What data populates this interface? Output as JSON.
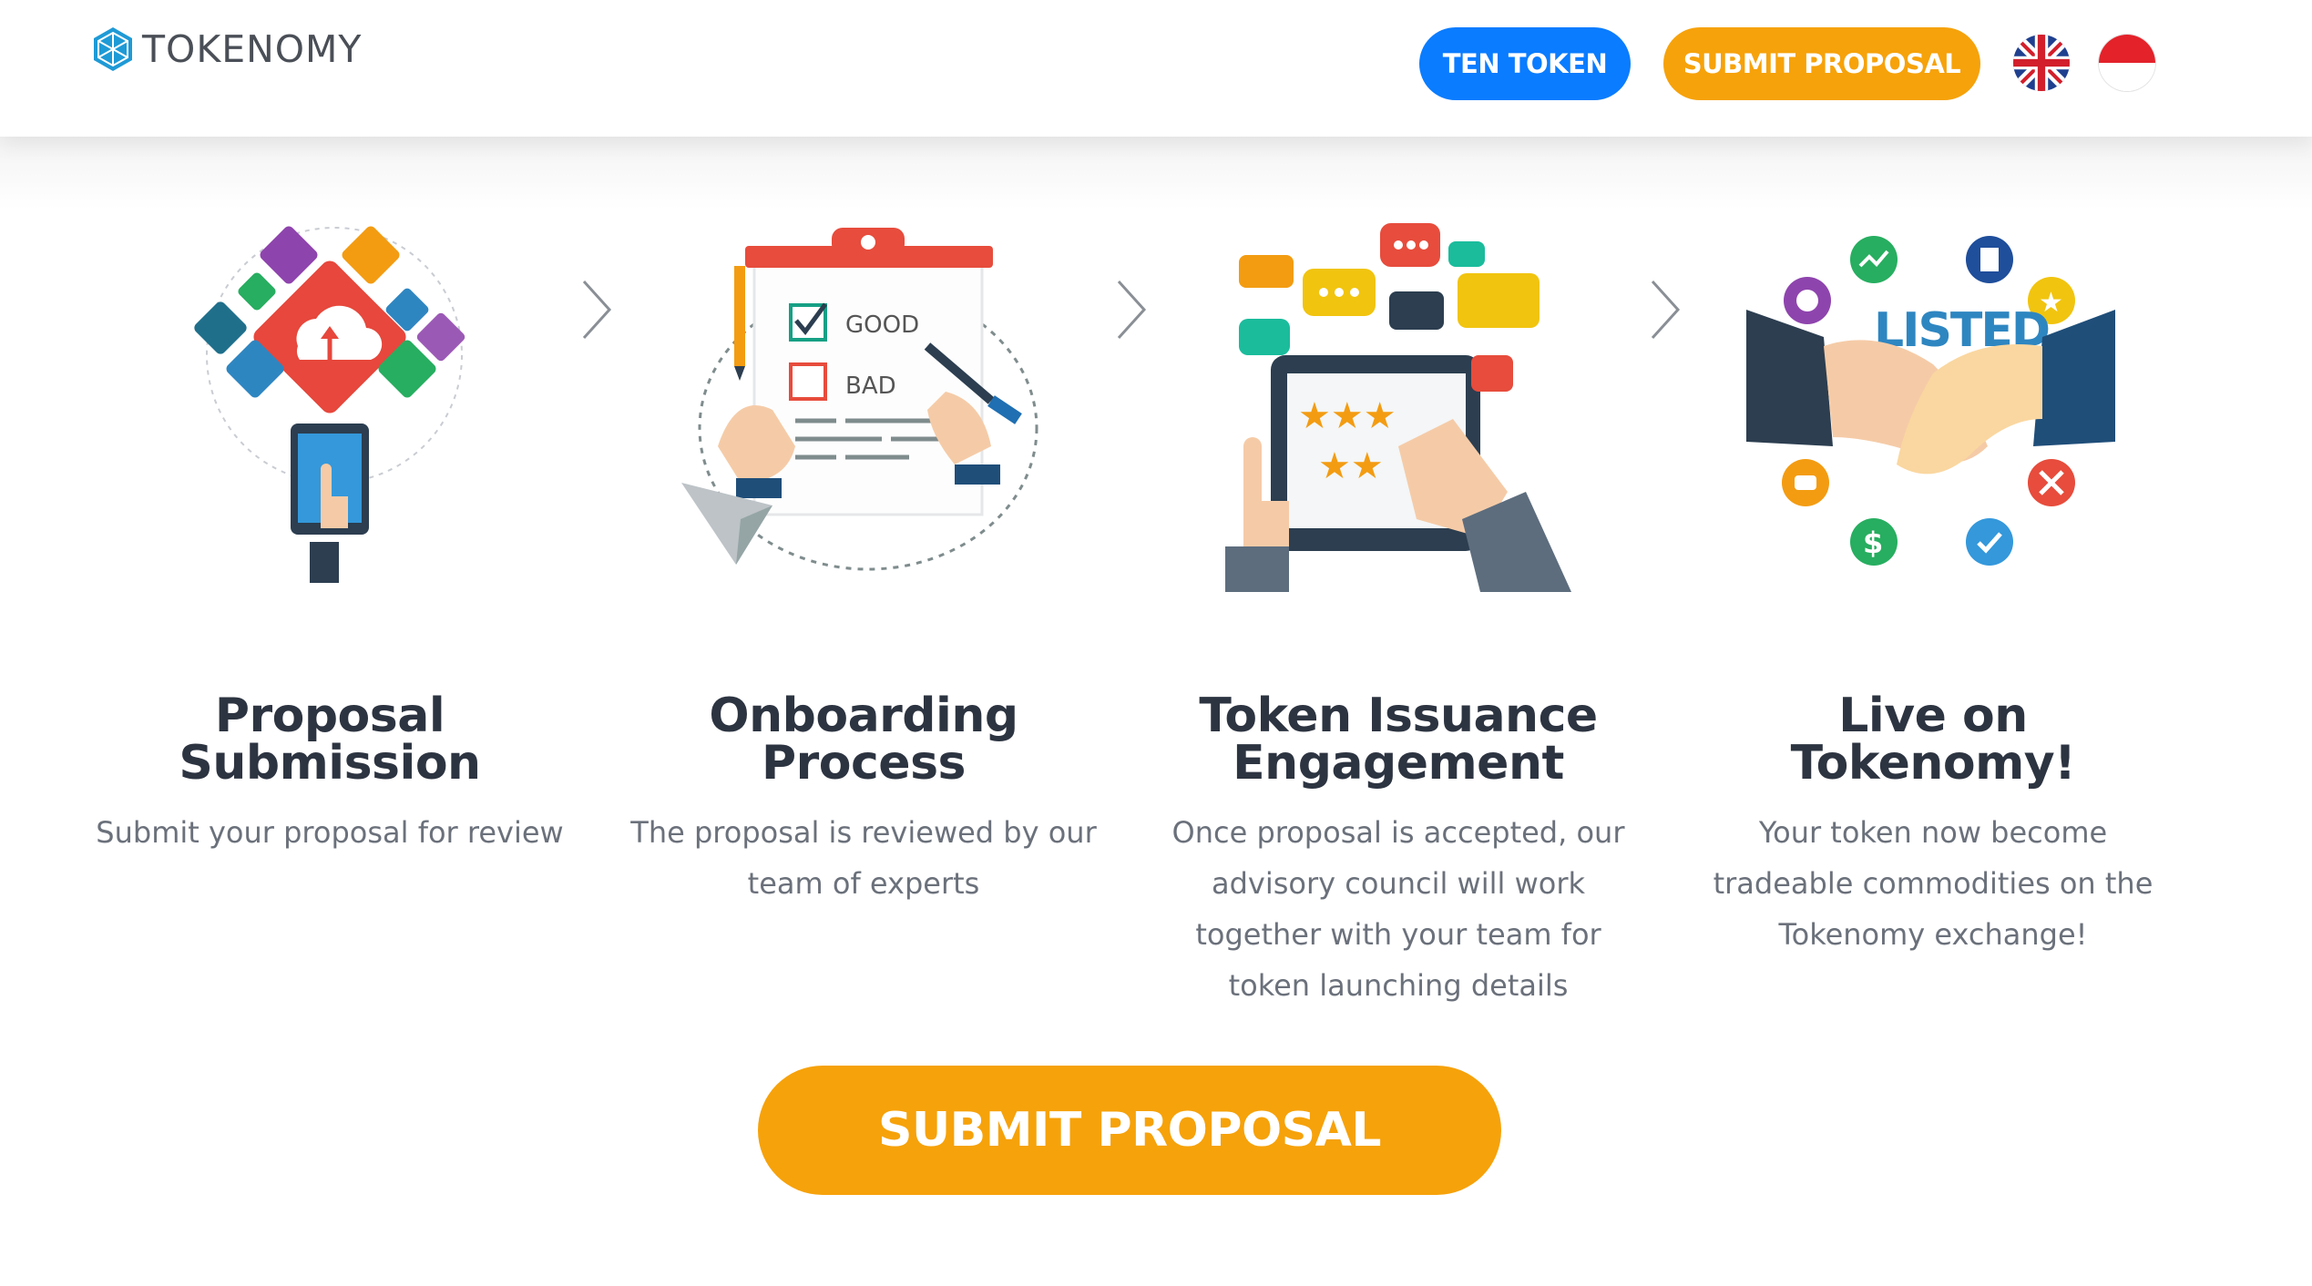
{
  "brand": {
    "name": "TOKENOMY"
  },
  "header": {
    "ten_token_label": "TEN TOKEN",
    "submit_label": "SUBMIT PROPOSAL",
    "languages": [
      "english-flag-icon",
      "indonesia-flag-icon"
    ]
  },
  "steps": [
    {
      "title": "Proposal Submission",
      "desc": "Submit your proposal for review",
      "icon": "proposal-submission-illustration"
    },
    {
      "title": "Onboarding Process",
      "desc": "The proposal is reviewed by our team of experts",
      "icon": "onboarding-checklist-illustration",
      "illustration_text": [
        "GOOD",
        "BAD"
      ]
    },
    {
      "title": "Token Issuance Engagement",
      "desc": "Once proposal is accepted, our advisory council will work together with your team for token launching details",
      "icon": "token-issuance-illustration"
    },
    {
      "title": "Live on Tokenomy!",
      "desc": "Your token now become tradeable commodities on the Tokenomy exchange!",
      "icon": "listed-handshake-illustration",
      "illustration_text": "LISTED"
    }
  ],
  "cta": {
    "label": "SUBMIT PROPOSAL"
  },
  "colors": {
    "blue": "#0a7cff",
    "orange": "#f6a20a",
    "heading": "#2d3441",
    "body_text": "#6b717b"
  }
}
